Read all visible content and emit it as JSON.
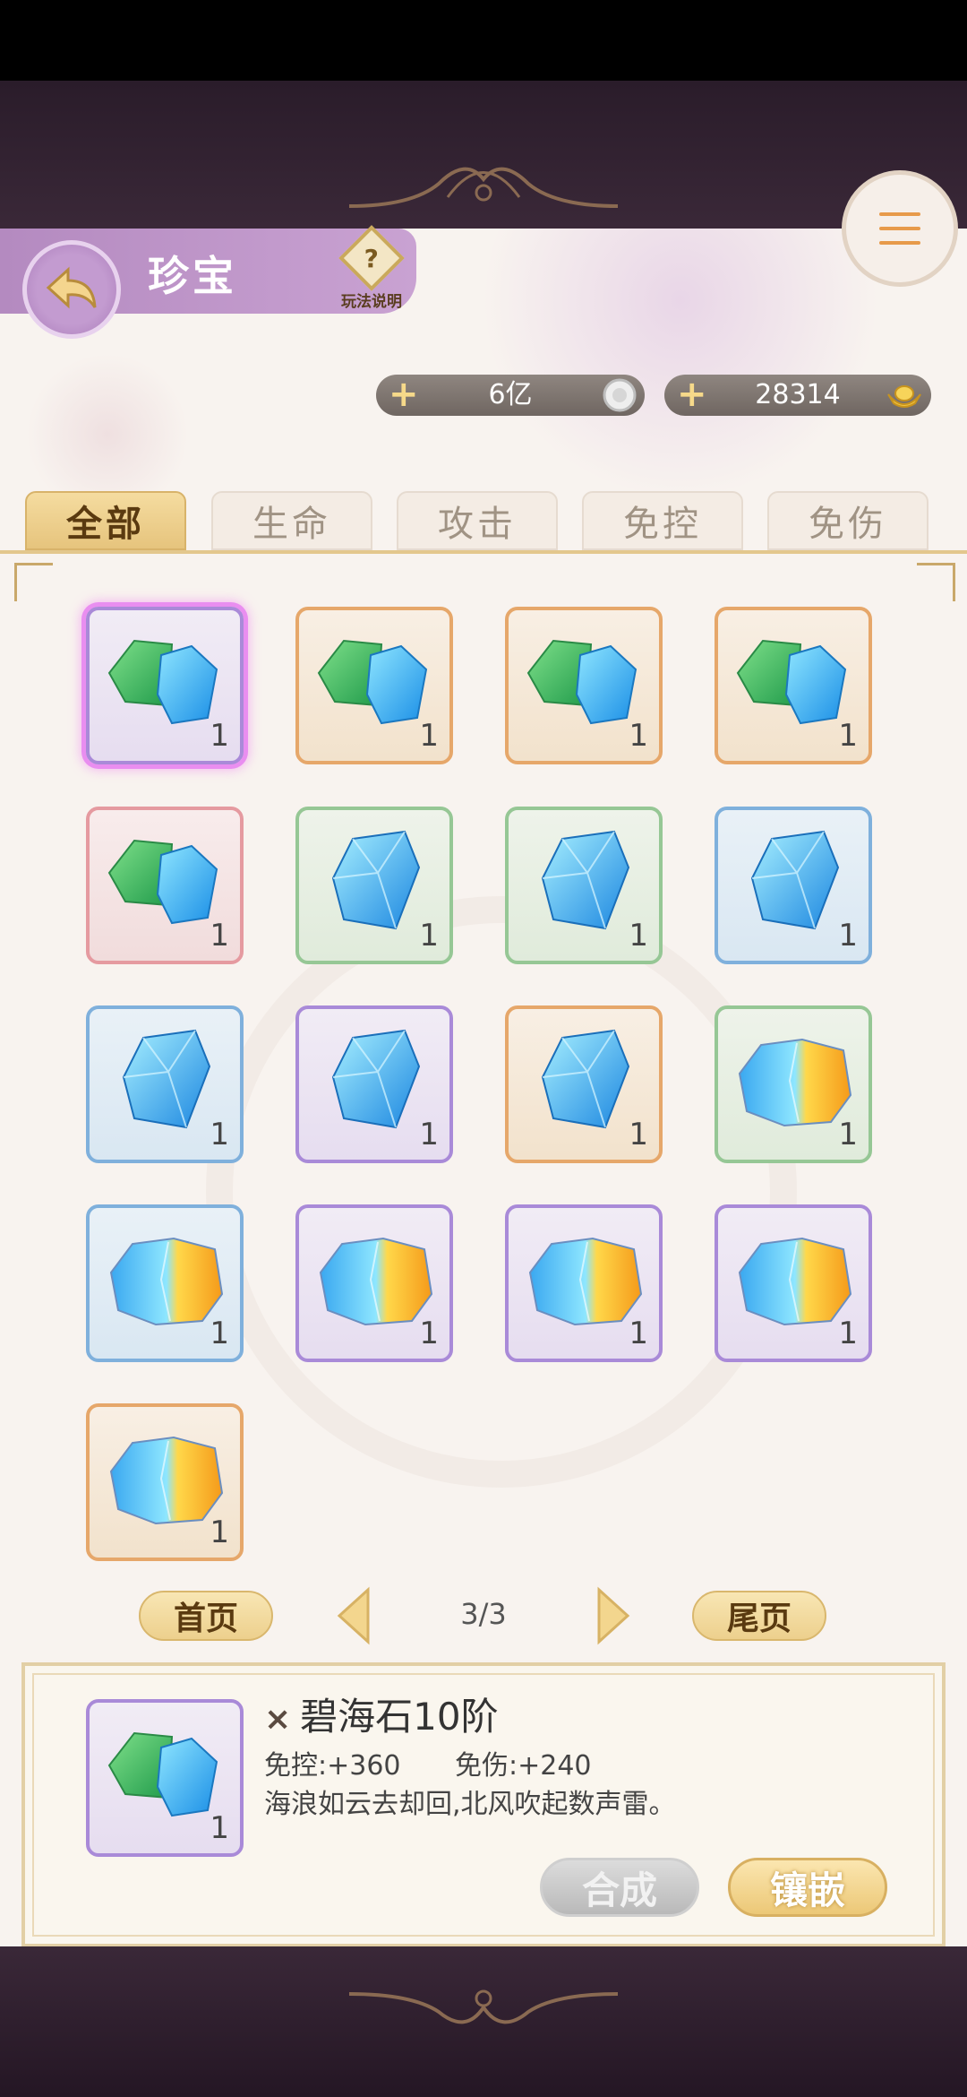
{
  "header": {
    "title": "珍宝",
    "help_label": "玩法说明"
  },
  "currencies": [
    {
      "value": "6亿",
      "icon": "silver-coin-icon"
    },
    {
      "value": "28314",
      "icon": "gold-ingot-icon"
    }
  ],
  "tabs": [
    {
      "label": "全部",
      "active": true
    },
    {
      "label": "生命",
      "active": false
    },
    {
      "label": "攻击",
      "active": false
    },
    {
      "label": "免控",
      "active": false
    },
    {
      "label": "免伤",
      "active": false
    }
  ],
  "items": [
    {
      "gem": "green-blue-gem",
      "rarity": "purple",
      "qty": "1",
      "selected": true
    },
    {
      "gem": "green-blue-gem",
      "rarity": "orange",
      "qty": "1"
    },
    {
      "gem": "green-blue-gem",
      "rarity": "orange",
      "qty": "1"
    },
    {
      "gem": "green-blue-gem",
      "rarity": "orange",
      "qty": "1"
    },
    {
      "gem": "green-blue-gem",
      "rarity": "red",
      "qty": "1"
    },
    {
      "gem": "blue-crystal",
      "rarity": "green",
      "qty": "1"
    },
    {
      "gem": "blue-crystal",
      "rarity": "green",
      "qty": "1"
    },
    {
      "gem": "blue-crystal",
      "rarity": "blue",
      "qty": "1"
    },
    {
      "gem": "blue-crystal",
      "rarity": "blue",
      "qty": "1"
    },
    {
      "gem": "blue-crystal",
      "rarity": "purple",
      "qty": "1"
    },
    {
      "gem": "blue-crystal",
      "rarity": "orange",
      "qty": "1"
    },
    {
      "gem": "blue-gold-gem",
      "rarity": "green",
      "qty": "1"
    },
    {
      "gem": "blue-gold-gem",
      "rarity": "blue",
      "qty": "1"
    },
    {
      "gem": "blue-gold-gem",
      "rarity": "purple",
      "qty": "1"
    },
    {
      "gem": "blue-gold-gem",
      "rarity": "purple",
      "qty": "1"
    },
    {
      "gem": "blue-gold-gem",
      "rarity": "purple",
      "qty": "1"
    },
    {
      "gem": "blue-gold-gem",
      "rarity": "orange",
      "qty": "1"
    }
  ],
  "pagination": {
    "first_label": "首页",
    "last_label": "尾页",
    "page": "3/3"
  },
  "detail": {
    "name": "碧海石10阶",
    "close_symbol": "×",
    "qty": "1",
    "stats": [
      "免控:+360",
      "免伤:+240"
    ],
    "description": "海浪如云去却回,北风吹起数声雷。",
    "compose_label": "合成",
    "inlay_label": "镶嵌"
  },
  "colors": {
    "accent_gold": "#e6c47d",
    "title_purple": "#b48ac0",
    "rarity": {
      "purple": "#a98ad8",
      "orange": "#e6a76a",
      "red": "#e59aa0",
      "green": "#96c795",
      "blue": "#7fb0dc"
    }
  }
}
